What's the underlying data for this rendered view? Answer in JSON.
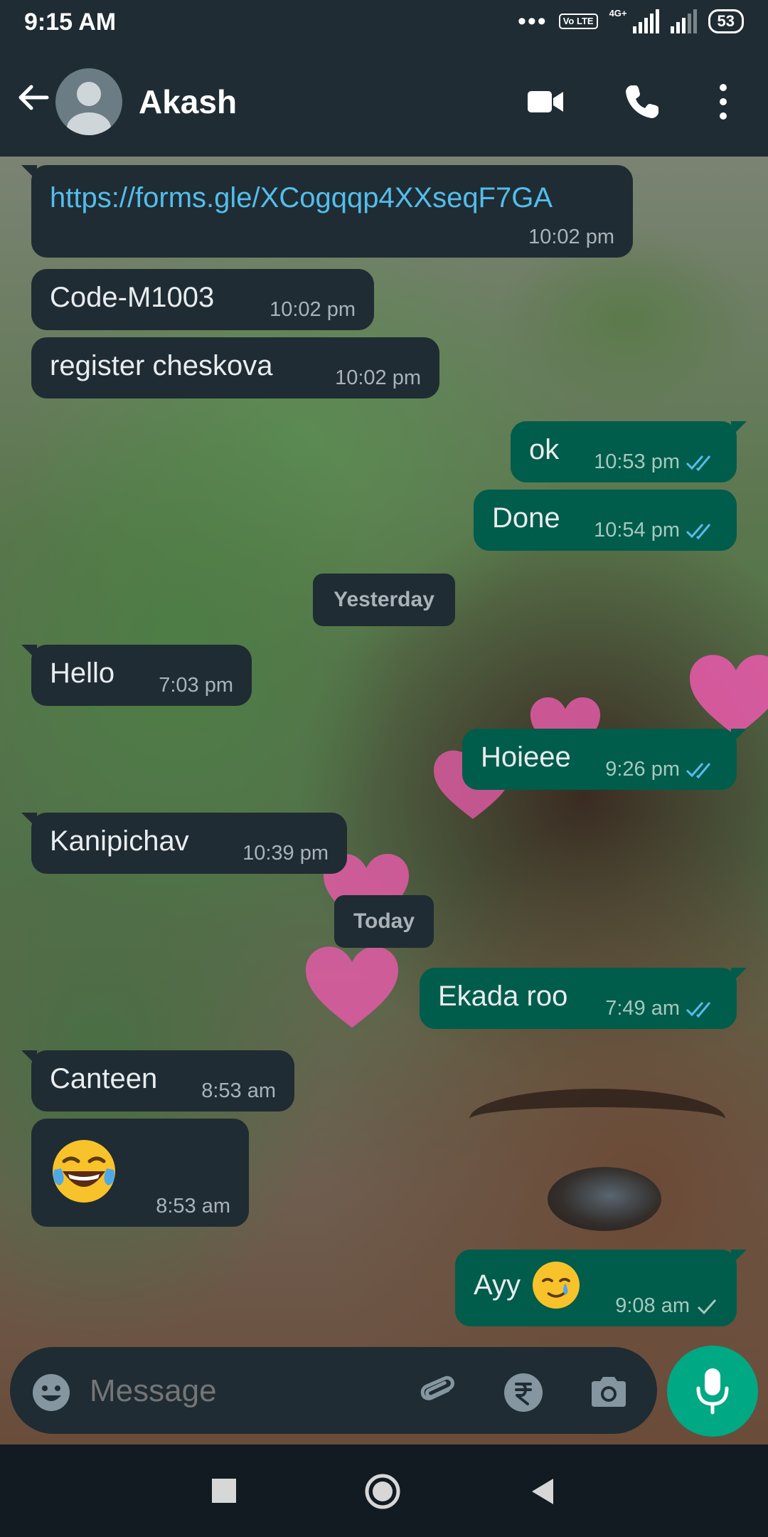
{
  "status_bar": {
    "time": "9:15 AM",
    "dots": "•••",
    "volte": "Vo LTE",
    "network": "4G+",
    "battery": "53"
  },
  "header": {
    "contact_name": "Akash",
    "icons": [
      "back-arrow-icon",
      "avatar",
      "video-call-icon",
      "phone-icon",
      "more-options-icon"
    ]
  },
  "messages": [
    {
      "dir": "in",
      "text": "https://forms.gle/XCogqqp4XXseqF7GA",
      "time": "10:02 pm",
      "link": true
    },
    {
      "dir": "in",
      "text": "Code-M1003",
      "time": "10:02 pm"
    },
    {
      "dir": "in",
      "text": "register cheskova",
      "time": "10:02 pm"
    },
    {
      "dir": "out",
      "text": "ok",
      "time": "10:53 pm",
      "status": "read"
    },
    {
      "dir": "out",
      "text": "Done",
      "time": "10:54 pm",
      "status": "read"
    },
    {
      "dir": "in",
      "text": "Hello",
      "time": "7:03 pm"
    },
    {
      "dir": "out",
      "text": "Hoieee",
      "time": "9:26 pm",
      "status": "read"
    },
    {
      "dir": "in",
      "text": "Kanipichav",
      "time": "10:39 pm"
    },
    {
      "dir": "out",
      "text": "Ekada roo",
      "time": "7:49 am",
      "status": "read"
    },
    {
      "dir": "in",
      "text": "Canteen",
      "time": "8:53 am"
    },
    {
      "dir": "in",
      "text": "",
      "emoji": "face-with-tears-of-joy",
      "time": "8:53 am"
    },
    {
      "dir": "out",
      "text": "Ayy",
      "emoji": "smiling-face-with-tear",
      "time": "9:08 am",
      "status": "sent"
    }
  ],
  "date_chips": {
    "yesterday": "Yesterday",
    "today": "Today"
  },
  "composer": {
    "placeholder": "Message"
  },
  "colors": {
    "header_bg": "#1f2c33",
    "incoming_bubble": "#1f2c33",
    "outgoing_bubble": "#005c4b",
    "link": "#53bdeb",
    "read_tick": "#53bdeb",
    "mic_button": "#00a884"
  }
}
